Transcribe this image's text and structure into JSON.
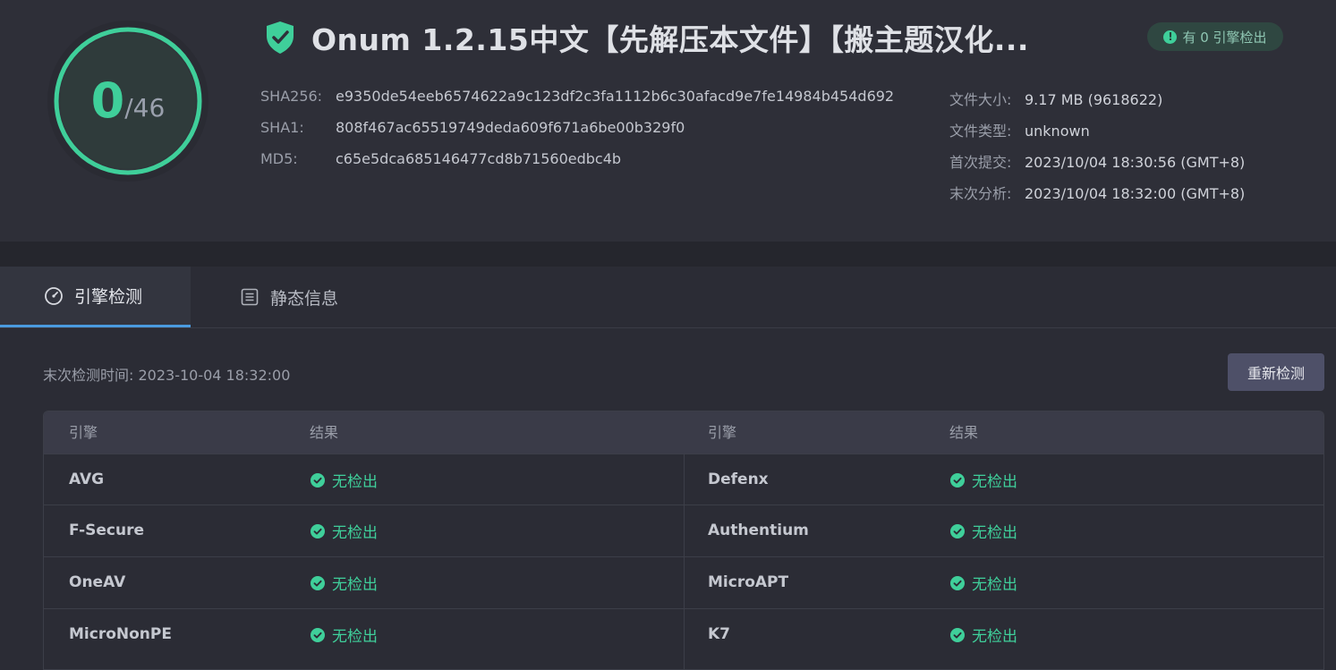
{
  "score": {
    "detected": "0",
    "total": "/46"
  },
  "title": "Onum 1.2.15中文【先解压本文件】【搬主题汉化...",
  "badge": {
    "label": "有 0 引擎检出",
    "icon": "exclamation-icon"
  },
  "hashes": [
    {
      "label": "SHA256:",
      "value": "e9350de54eeb6574622a9c123df2c3fa1112b6c30afacd9e7fe14984b454d692"
    },
    {
      "label": "SHA1:",
      "value": "808f467ac65519749deda609f671a6be00b329f0"
    },
    {
      "label": "MD5:",
      "value": "c65e5dca685146477cd8b71560edbc4b"
    }
  ],
  "file_info": [
    {
      "label": "文件大小:",
      "value": "9.17 MB (9618622)"
    },
    {
      "label": "文件类型:",
      "value": "unknown"
    },
    {
      "label": "首次提交:",
      "value": "2023/10/04 18:30:56 (GMT+8)"
    },
    {
      "label": "末次分析:",
      "value": "2023/10/04 18:32:00 (GMT+8)"
    }
  ],
  "tabs": [
    {
      "label": "引擎检测",
      "icon": "gauge-icon",
      "active": true
    },
    {
      "label": "静态信息",
      "icon": "document-list-icon",
      "active": false
    }
  ],
  "last_scan": "末次检测时间: 2023-10-04 18:32:00",
  "rescan_label": "重新检测",
  "table": {
    "headers": [
      "引擎",
      "结果",
      "引擎",
      "结果"
    ],
    "rows": [
      {
        "left_engine": "AVG",
        "left_result": "无检出",
        "right_engine": "Defenx",
        "right_result": "无检出"
      },
      {
        "left_engine": "F-Secure",
        "left_result": "无检出",
        "right_engine": "Authentium",
        "right_result": "无检出"
      },
      {
        "left_engine": "OneAV",
        "left_result": "无检出",
        "right_engine": "MicroAPT",
        "right_result": "无检出"
      },
      {
        "left_engine": "MicroNonPE",
        "left_result": "无检出",
        "right_engine": "K7",
        "right_result": "无检出"
      }
    ]
  },
  "colors": {
    "accent": "#3fcf9a",
    "tab_underline": "#4a9be0",
    "background": "#2b2c35"
  }
}
